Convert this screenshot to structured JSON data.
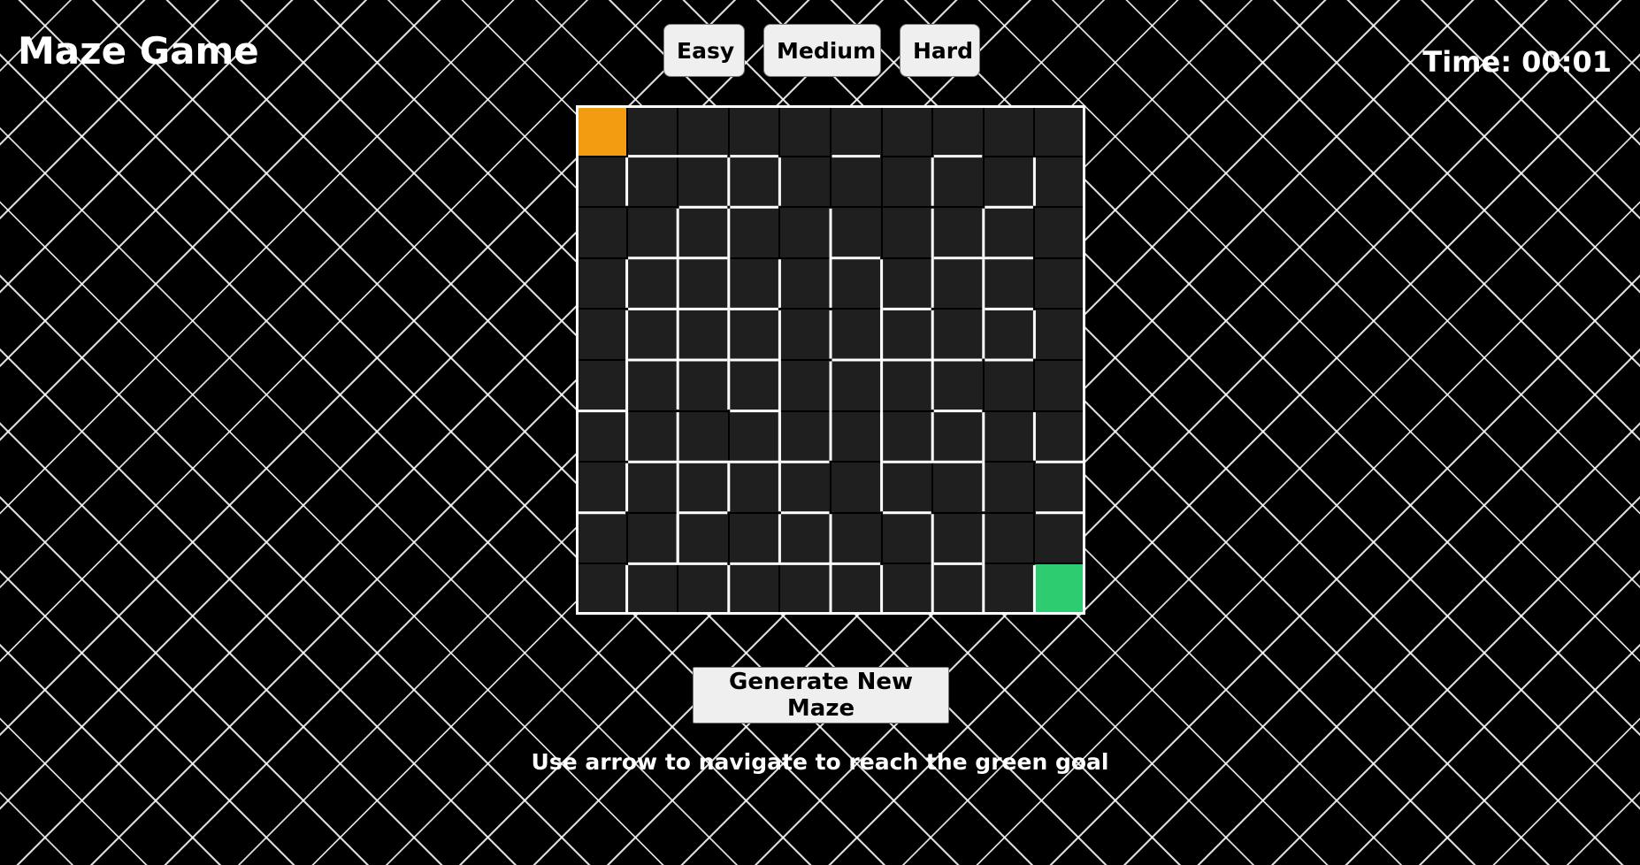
{
  "app": {
    "title": "Maze Game"
  },
  "timer": {
    "label": "Time: 00:01"
  },
  "difficulty": {
    "easy_label": "Easy",
    "medium_label": "Medium",
    "hard_label": "Hard"
  },
  "maze": {
    "rows": 10,
    "cols": 10,
    "start": [
      0,
      0
    ],
    "goal": [
      9,
      9
    ],
    "wall_color": "#ffffff",
    "cell_color": "#1f1f1f",
    "start_color": "#f39c12",
    "goal_color": "#2ecc71"
  },
  "controls": {
    "generate_label": "Generate New Maze"
  },
  "instructions": {
    "text": "Use arrow to navigate to reach the green goal"
  }
}
